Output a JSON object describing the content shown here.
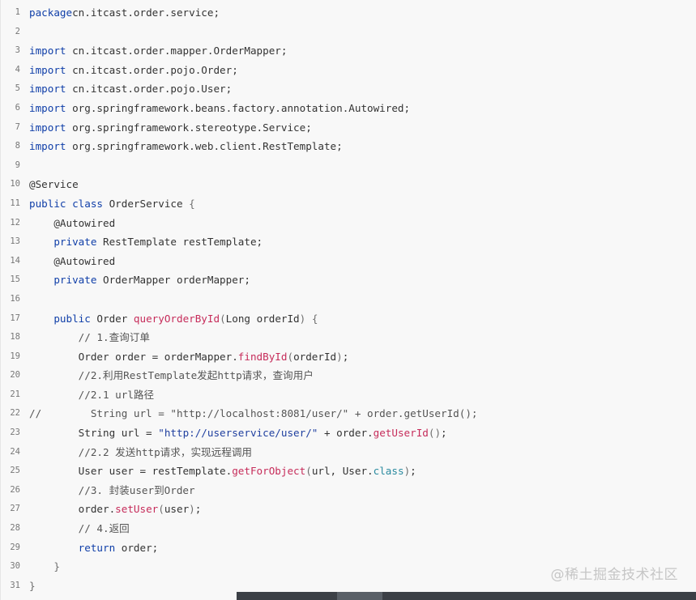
{
  "editor": {
    "lines": [
      {
        "n": "1",
        "parts": [
          [
            "kw",
            "package"
          ],
          [
            "",
            "cn.itcast.order.service;"
          ]
        ]
      },
      {
        "n": "2",
        "parts": []
      },
      {
        "n": "3",
        "parts": [
          [
            "kw",
            "import"
          ],
          [
            "",
            " cn.itcast.order.mapper.OrderMapper;"
          ]
        ]
      },
      {
        "n": "4",
        "parts": [
          [
            "kw",
            "import"
          ],
          [
            "",
            " cn.itcast.order.pojo.Order;"
          ]
        ]
      },
      {
        "n": "5",
        "parts": [
          [
            "kw",
            "import"
          ],
          [
            "",
            " cn.itcast.order.pojo.User;"
          ]
        ]
      },
      {
        "n": "6",
        "parts": [
          [
            "kw",
            "import"
          ],
          [
            "",
            " org.springframework.beans.factory.annotation.Autowired;"
          ]
        ]
      },
      {
        "n": "7",
        "parts": [
          [
            "kw",
            "import"
          ],
          [
            "",
            " org.springframework.stereotype.Service;"
          ]
        ]
      },
      {
        "n": "8",
        "parts": [
          [
            "kw",
            "import"
          ],
          [
            "",
            " org.springframework.web.client.RestTemplate;"
          ]
        ]
      },
      {
        "n": "9",
        "parts": []
      },
      {
        "n": "10",
        "parts": [
          [
            "",
            "@Service"
          ]
        ]
      },
      {
        "n": "11",
        "parts": [
          [
            "kw",
            "public class"
          ],
          [
            "",
            " OrderService "
          ],
          [
            "pn",
            "{"
          ]
        ]
      },
      {
        "n": "12",
        "parts": [
          [
            "",
            "    @Autowired"
          ]
        ]
      },
      {
        "n": "13",
        "parts": [
          [
            "kw",
            "    private"
          ],
          [
            "",
            " RestTemplate restTemplate;"
          ]
        ]
      },
      {
        "n": "14",
        "parts": [
          [
            "",
            "    @Autowired"
          ]
        ]
      },
      {
        "n": "15",
        "parts": [
          [
            "kw",
            "    private"
          ],
          [
            "",
            " OrderMapper orderMapper;"
          ]
        ]
      },
      {
        "n": "16",
        "parts": []
      },
      {
        "n": "17",
        "parts": [
          [
            "kw",
            "    public"
          ],
          [
            "",
            " Order "
          ],
          [
            "fn",
            "queryOrderById"
          ],
          [
            "pn",
            "("
          ],
          [
            "",
            "Long orderId"
          ],
          [
            "pn",
            ")"
          ],
          [
            "",
            " "
          ],
          [
            "pn",
            "{"
          ]
        ]
      },
      {
        "n": "18",
        "parts": [
          [
            "cm",
            "        // 1.查询订单"
          ]
        ]
      },
      {
        "n": "19",
        "parts": [
          [
            "",
            "        Order order = orderMapper."
          ],
          [
            "fn",
            "findById"
          ],
          [
            "pn",
            "("
          ],
          [
            "",
            "orderId"
          ],
          [
            "pn",
            ")"
          ],
          [
            "",
            ";"
          ]
        ]
      },
      {
        "n": "20",
        "parts": [
          [
            "cm",
            "        //2.利用RestTemplate发起http请求，查询用户"
          ]
        ]
      },
      {
        "n": "21",
        "parts": [
          [
            "cm",
            "        //2.1 url路径"
          ]
        ]
      },
      {
        "n": "22",
        "parts": [
          [
            "cm",
            "//        String url = \"http://localhost:8081/user/\" + order.getUserId();"
          ]
        ]
      },
      {
        "n": "23",
        "parts": [
          [
            "",
            "        String url = "
          ],
          [
            "str",
            "\"http://userservice/user/\""
          ],
          [
            "",
            " + order."
          ],
          [
            "fn",
            "getUserId"
          ],
          [
            "pn",
            "()"
          ],
          [
            "",
            ";"
          ]
        ]
      },
      {
        "n": "24",
        "parts": [
          [
            "cm",
            "        //2.2 发送http请求，实现远程调用"
          ]
        ]
      },
      {
        "n": "25",
        "parts": [
          [
            "",
            "        User user = restTemplate."
          ],
          [
            "fn",
            "getForObject"
          ],
          [
            "pn",
            "("
          ],
          [
            "",
            "url, User."
          ],
          [
            "bt",
            "class"
          ],
          [
            "pn",
            ")"
          ],
          [
            "",
            ";"
          ]
        ]
      },
      {
        "n": "26",
        "parts": [
          [
            "cm",
            "        //3. 封装user到Order"
          ]
        ]
      },
      {
        "n": "27",
        "parts": [
          [
            "",
            "        order."
          ],
          [
            "fn",
            "setUser"
          ],
          [
            "pn",
            "("
          ],
          [
            "",
            "user"
          ],
          [
            "pn",
            ")"
          ],
          [
            "",
            ";"
          ]
        ]
      },
      {
        "n": "28",
        "parts": [
          [
            "cm",
            "        // 4.返回"
          ]
        ]
      },
      {
        "n": "29",
        "parts": [
          [
            "kw",
            "        return"
          ],
          [
            "",
            " order;"
          ]
        ]
      },
      {
        "n": "30",
        "parts": [
          [
            "pn",
            "    }"
          ]
        ]
      },
      {
        "n": "31",
        "parts": [
          [
            "pn",
            "}"
          ]
        ]
      }
    ]
  },
  "watermark": "@稀土掘金技术社区"
}
